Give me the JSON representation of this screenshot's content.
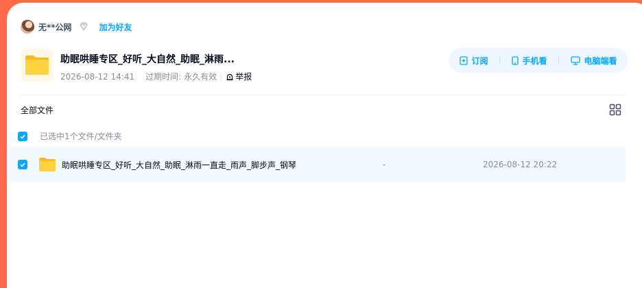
{
  "sharer": {
    "name": "无**公网",
    "add_friend": "加为好友"
  },
  "share": {
    "title": "助眠哄睡专区_好听_大自然_助眠_淋雨...",
    "date": "2026-08-12 14:41",
    "expire_label": "过期时间:",
    "expire_value": "永久有效",
    "report": "举报"
  },
  "actions": {
    "subscribe": "订阅",
    "mobile": "手机看",
    "pc": "电脑端看"
  },
  "breadcrumb": "全部文件",
  "selection": {
    "text": "已选中1个文件/文件夹"
  },
  "files": [
    {
      "name": "助眠哄睡专区_好听_大自然_助眠_淋雨一直走_雨声_脚步声_钢琴",
      "size": "-",
      "time": "2026-08-12 20:22"
    }
  ],
  "colors": {
    "page_background": "#ff6b4a",
    "accent": "#06a7ff",
    "selected_row": "#f2f9ff",
    "folder": "#ffc62d"
  }
}
